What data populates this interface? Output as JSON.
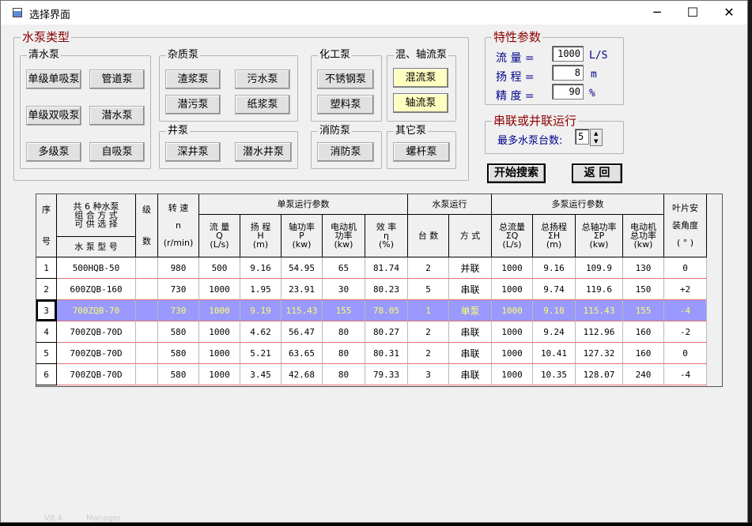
{
  "window": {
    "title": "选择界面",
    "minimize": "─",
    "maximize": "☐",
    "close": "✕"
  },
  "pump_types": {
    "title": "水泵类型",
    "clear_water": {
      "title": "清水泵",
      "buttons": [
        "单级单吸泵",
        "管道泵",
        "单级双吸泵",
        "潜水泵",
        "多级泵",
        "自吸泵"
      ]
    },
    "impurity": {
      "title": "杂质泵",
      "buttons": [
        "渣浆泵",
        "污水泵",
        "潜污泵",
        "纸浆泵"
      ]
    },
    "chemical": {
      "title": "化工泵",
      "buttons": [
        "不锈钢泵",
        "塑料泵"
      ]
    },
    "mixed_axial": {
      "title": "混、轴流泵",
      "buttons": [
        "混流泵",
        "轴流泵"
      ]
    },
    "well": {
      "title": "井泵",
      "buttons": [
        "深井泵",
        "潜水井泵"
      ]
    },
    "fire": {
      "title": "消防泵",
      "buttons": [
        "消防泵"
      ]
    },
    "other": {
      "title": "其它泵",
      "buttons": [
        "螺杆泵"
      ]
    }
  },
  "params": {
    "title": "特性参数",
    "flow_label": "流  量 =",
    "flow_value": "1000",
    "flow_unit": "L/S",
    "head_label": "扬  程 =",
    "head_value": "8",
    "head_unit": "m",
    "accuracy_label": "精  度 =",
    "accuracy_value": "90",
    "accuracy_unit": "%"
  },
  "series": {
    "title": "串联或并联运行",
    "max_label": "最多水泵台数:",
    "max_value": "5"
  },
  "actions": {
    "search": "开始搜索",
    "back": "返  回"
  },
  "table": {
    "h_no_top": "序",
    "h_no_bot": "号",
    "h_combo": "共 6 种水泵\n组 合 方 式\n可 供 选 择",
    "h_model": "水 泵 型 号",
    "h_stage_top": "级",
    "h_stage_bot": "数",
    "h_speed": "转  速\n\nn\n\n(r/min)",
    "h_single": "单泵运行参数",
    "h_flow": "流  量\nQ\n(L/s)",
    "h_head": "扬  程\nH\n(m)",
    "h_shaft": "轴功率\nP\n(kw)",
    "h_motor": "电动机\n功率\n(kw)",
    "h_eff": "效  率\nη\n(%)",
    "h_run": "水泵运行",
    "h_count": "台  数",
    "h_mode": "方  式",
    "h_multi": "多泵运行参数",
    "h_tflow": "总流量\nΣQ\n(L/s)",
    "h_thead": "总扬程\nΣH\n(m)",
    "h_tshaft": "总轴功率\nΣP\n(kw)",
    "h_tmotor": "电动机\n总功率\n(kw)",
    "h_blade": "叶片安\n\n装角度\n\n( ° )",
    "rows": [
      {
        "no": "1",
        "model": "500HQB-50",
        "stage": "",
        "speed": "980",
        "flow": "500",
        "head": "9.16",
        "shaft": "54.95",
        "motor": "65",
        "eff": "81.74",
        "count": "2",
        "mode": "并联",
        "tflow": "1000",
        "thead": "9.16",
        "tshaft": "109.9",
        "tmotor": "130",
        "blade": "0"
      },
      {
        "no": "2",
        "model": "600ZQB-160",
        "stage": "",
        "speed": "730",
        "flow": "1000",
        "head": "1.95",
        "shaft": "23.91",
        "motor": "30",
        "eff": "80.23",
        "count": "5",
        "mode": "串联",
        "tflow": "1000",
        "thead": "9.74",
        "tshaft": "119.6",
        "tmotor": "150",
        "blade": "+2"
      },
      {
        "no": "3",
        "model": "700ZQB-70",
        "stage": "",
        "speed": "730",
        "flow": "1000",
        "head": "9.19",
        "shaft": "115.43",
        "motor": "155",
        "eff": "78.05",
        "count": "1",
        "mode": "单泵",
        "tflow": "1000",
        "thead": "9.18",
        "tshaft": "115.43",
        "tmotor": "155",
        "blade": "-4"
      },
      {
        "no": "4",
        "model": "700ZQB-70D",
        "stage": "",
        "speed": "580",
        "flow": "1000",
        "head": "4.62",
        "shaft": "56.47",
        "motor": "80",
        "eff": "80.27",
        "count": "2",
        "mode": "串联",
        "tflow": "1000",
        "thead": "9.24",
        "tshaft": "112.96",
        "tmotor": "160",
        "blade": "-2"
      },
      {
        "no": "5",
        "model": "700ZQB-70D",
        "stage": "",
        "speed": "580",
        "flow": "1000",
        "head": "5.21",
        "shaft": "63.65",
        "motor": "80",
        "eff": "80.31",
        "count": "2",
        "mode": "串联",
        "tflow": "1000",
        "thead": "10.41",
        "tshaft": "127.32",
        "tmotor": "160",
        "blade": "0"
      },
      {
        "no": "6",
        "model": "700ZQB-70D",
        "stage": "",
        "speed": "580",
        "flow": "1000",
        "head": "3.45",
        "shaft": "42.68",
        "motor": "80",
        "eff": "79.33",
        "count": "3",
        "mode": "串联",
        "tflow": "1000",
        "thead": "10.35",
        "tshaft": "128.07",
        "tmotor": "240",
        "blade": "-4"
      }
    ],
    "selected_row": 2
  },
  "taskbar": {
    "left_text": "V8.4",
    "mid_text": "Manager"
  }
}
